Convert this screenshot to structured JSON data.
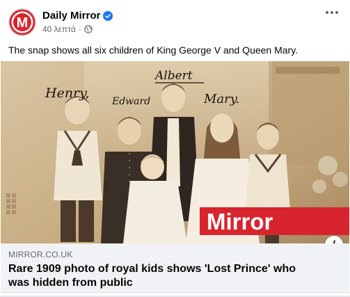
{
  "post": {
    "page_name": "Daily Mirror",
    "time": "40 λεπτά",
    "separator": "·",
    "caption": "The snap shows all six children of King George V and Queen Mary.",
    "avatar_letter": "M"
  },
  "photo": {
    "names": {
      "henry": "Henry,",
      "edward": "Edward",
      "albert": "Albert",
      "mary": "Mary."
    },
    "watermark": "Mirror"
  },
  "link": {
    "domain": "MIRROR.CO.UK",
    "title": "Rare 1909 photo of royal kids shows 'Lost Prince' who was hidden from public",
    "info_label": "i"
  },
  "colors": {
    "brand_red": "#d8252d",
    "verified_blue": "#1877f2",
    "link_bg": "#f0f2f5"
  },
  "icons": [
    "mirror-logo",
    "verified-badge-icon",
    "globe-icon",
    "more-options-icon",
    "info-icon"
  ]
}
